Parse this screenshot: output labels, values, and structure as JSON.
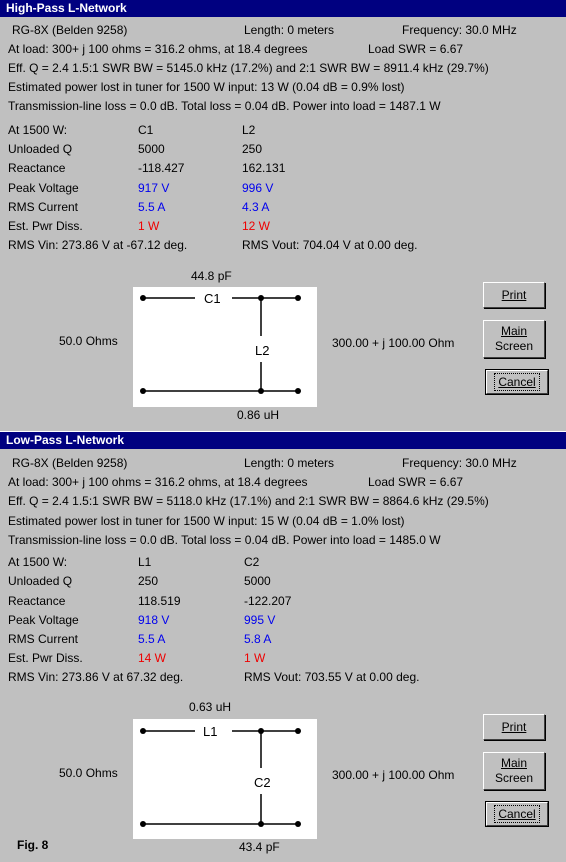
{
  "high_pass": {
    "title": "High-Pass L-Network",
    "cable": "RG-8X (Belden 9258)",
    "length": "Length:  0 meters",
    "frequency": "Frequency:  30.0 MHz",
    "at_load": "At load:  300+ j  100 ohms =  316.2 ohms, at  18.4 degrees",
    "load_swr": "Load SWR =  6.67",
    "effq": "Eff. Q = 2.4    1.5:1 SWR BW = 5145.0 kHz (17.2%) and 2:1 SWR BW = 8911.4 kHz (29.7%)",
    "power_lost": "Estimated power lost in tuner for 1500 W input:   13 W (0.04 dB = 0.9% lost)",
    "tline_loss": "Transmission-line loss = 0.0 dB.  Total loss = 0.04 dB.  Power into load = 1487.1 W",
    "table": {
      "col0_header": "At 1500 W:",
      "col1_header": "C1",
      "col2_header": "L2",
      "rows": [
        {
          "label": "Unloaded Q",
          "v1": "5000",
          "v2": "250",
          "color": "black"
        },
        {
          "label": "Reactance",
          "v1": "-118.427",
          "v2": "162.131",
          "color": "black"
        },
        {
          "label": "Peak Voltage",
          "v1": "917 V",
          "v2": "996 V",
          "color": "blue"
        },
        {
          "label": "RMS Current",
          "v1": "5.5 A",
          "v2": "4.3 A",
          "color": "blue"
        },
        {
          "label": "Est. Pwr Diss.",
          "v1": "1 W",
          "v2": "12 W",
          "color": "red"
        }
      ]
    },
    "rms_vin": "RMS Vin:   273.86 V at -67.12 deg.",
    "rms_vout": "RMS Vout:  704.04 V at 0.00 deg.",
    "series_value": "44.8 pF",
    "series_label": "C1",
    "shunt_label": "L2",
    "shunt_value": "0.86 uH",
    "source_ohms": "50.0 Ohms",
    "load_ohms": "300.00 + j 100.00 Ohm",
    "buttons": {
      "print": "Print",
      "main": "Main",
      "screen": "Screen",
      "cancel": "Cancel"
    }
  },
  "low_pass": {
    "title": "Low-Pass L-Network",
    "cable": "RG-8X (Belden 9258)",
    "length": "Length:  0 meters",
    "frequency": "Frequency:  30.0 MHz",
    "at_load": "At load:  300+ j  100 ohms =  316.2 ohms, at  18.4 degrees",
    "load_swr": "Load SWR =  6.67",
    "effq": "Eff. Q = 2.4    1.5:1 SWR BW = 5118.0 kHz (17.1%) and 2:1 SWR BW = 8864.6 kHz (29.5%)",
    "power_lost": "Estimated power lost in tuner for 1500 W input:   15 W (0.04 dB = 1.0% lost)",
    "tline_loss": "Transmission-line loss = 0.0 dB.  Total loss = 0.04 dB.  Power into load = 1485.0 W",
    "table": {
      "col0_header": "At 1500 W:",
      "col1_header": "L1",
      "col2_header": "C2",
      "rows": [
        {
          "label": "Unloaded Q",
          "v1": "250",
          "v2": "5000",
          "color": "black"
        },
        {
          "label": "Reactance",
          "v1": "118.519",
          "v2": "-122.207",
          "color": "black"
        },
        {
          "label": "Peak Voltage",
          "v1": "918 V",
          "v2": "995 V",
          "color": "blue"
        },
        {
          "label": "RMS Current",
          "v1": "5.5 A",
          "v2": "5.8 A",
          "color": "blue"
        },
        {
          "label": "Est. Pwr Diss.",
          "v1": "14 W",
          "v2": "1 W",
          "color": "red"
        }
      ]
    },
    "rms_vin": "RMS Vin:   273.86 V at 67.32 deg.",
    "rms_vout": "RMS Vout:  703.55 V at 0.00 deg.",
    "series_value": "0.63 uH",
    "series_label": "L1",
    "shunt_label": "C2",
    "shunt_value": "43.4 pF",
    "source_ohms": "50.0 Ohms",
    "load_ohms": "300.00 + j 100.00 Ohm",
    "buttons": {
      "print": "Print",
      "main": "Main",
      "screen": "Screen",
      "cancel": "Cancel"
    }
  },
  "figure_label": "Fig. 8"
}
